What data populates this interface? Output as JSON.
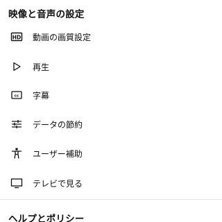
{
  "sections": [
    {
      "title": "映像と音声の設定",
      "items": [
        {
          "label": "動画の画質設定",
          "icon": "hd-icon"
        },
        {
          "label": "再生",
          "icon": "play-outline-icon"
        },
        {
          "label": "字幕",
          "icon": "closed-captions-icon"
        },
        {
          "label": "データの節約",
          "icon": "sliders-icon"
        },
        {
          "label": "ユーザー補助",
          "icon": "accessibility-person-icon"
        },
        {
          "label": "テレビで見る",
          "icon": "tv-icon"
        }
      ]
    },
    {
      "title": "ヘルプとポリシー"
    }
  ],
  "colors": {
    "text": "#0f0f0f",
    "divider": "#e5e5e5",
    "background": "#ffffff"
  }
}
